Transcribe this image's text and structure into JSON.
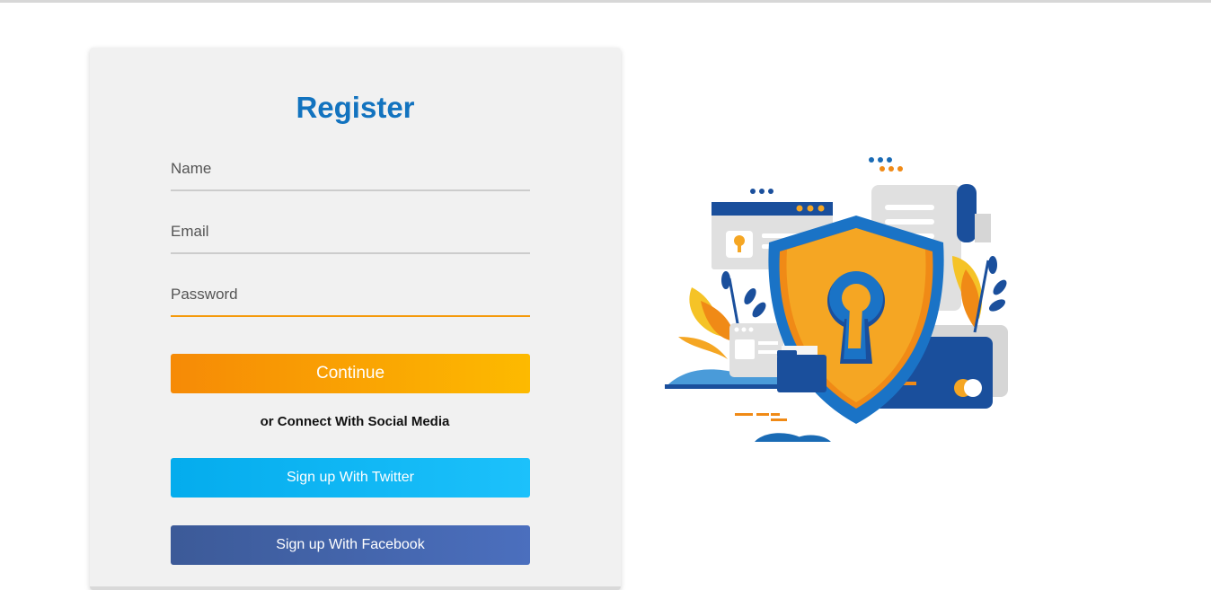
{
  "form": {
    "title": "Register",
    "fields": {
      "name": {
        "placeholder": "Name",
        "value": ""
      },
      "email": {
        "placeholder": "Email",
        "value": ""
      },
      "password": {
        "placeholder": "Password",
        "value": ""
      }
    },
    "continue_label": "Continue",
    "social_text": "or Connect With Social Media",
    "twitter_label": "Sign up With Twitter",
    "facebook_label": "Sign up With Facebook"
  },
  "colors": {
    "title": "#1273bf",
    "active_underline": "#f59a0b",
    "continue_gradient": [
      "#f68a06",
      "#fdba00"
    ],
    "twitter_gradient": [
      "#04aced",
      "#1cc1fb"
    ],
    "facebook_gradient": [
      "#3c5a98",
      "#4b6fbe"
    ]
  },
  "illustration": {
    "icon": "security-shield-keyhole-icon"
  }
}
